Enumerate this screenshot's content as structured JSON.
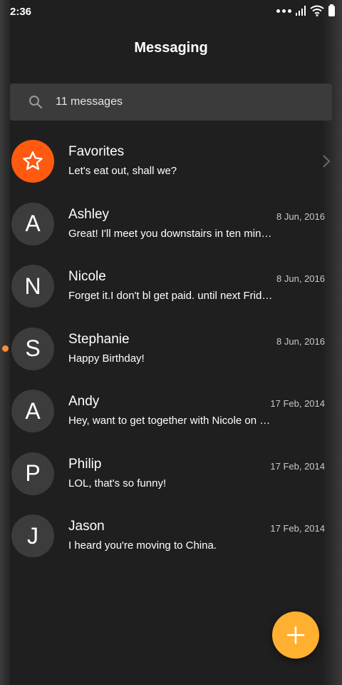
{
  "status_bar": {
    "time": "2:36"
  },
  "header": {
    "title": "Messaging"
  },
  "search": {
    "text": "11 messages",
    "icon": "search-icon"
  },
  "conversations": [
    {
      "avatar": "star-icon",
      "name": "Favorites",
      "date": "",
      "preview": "Let's eat out, shall we?",
      "has_chevron": true,
      "unread": false
    },
    {
      "avatar": "A",
      "name": "Ashley",
      "date": "8 Jun, 2016",
      "preview": "Great! I'll meet you downstairs in ten min…",
      "unread": false
    },
    {
      "avatar": "N",
      "name": "Nicole",
      "date": "8 Jun, 2016",
      "preview": "Forget it.I don't bl get paid. until next Frid…",
      "unread": false
    },
    {
      "avatar": "S",
      "name": "Stephanie",
      "date": "8 Jun, 2016",
      "preview": "Happy Birthday!",
      "unread": true
    },
    {
      "avatar": "A",
      "name": "Andy",
      "date": "17 Feb, 2014",
      "preview": "Hey, want to get together with Nicole on …",
      "unread": false
    },
    {
      "avatar": "P",
      "name": "Philip",
      "date": "17 Feb, 2014",
      "preview": "LOL, that's so funny!",
      "unread": false
    },
    {
      "avatar": "J",
      "name": "Jason",
      "date": "17 Feb, 2014",
      "preview": "I heard you're moving to China.",
      "unread": false
    }
  ],
  "fab": {
    "icon": "plus-icon"
  },
  "colors": {
    "accent": "#ffb030",
    "favorite": "#ff5a10",
    "unread_dot": "#ff8c33",
    "background": "#1f1f1f"
  }
}
